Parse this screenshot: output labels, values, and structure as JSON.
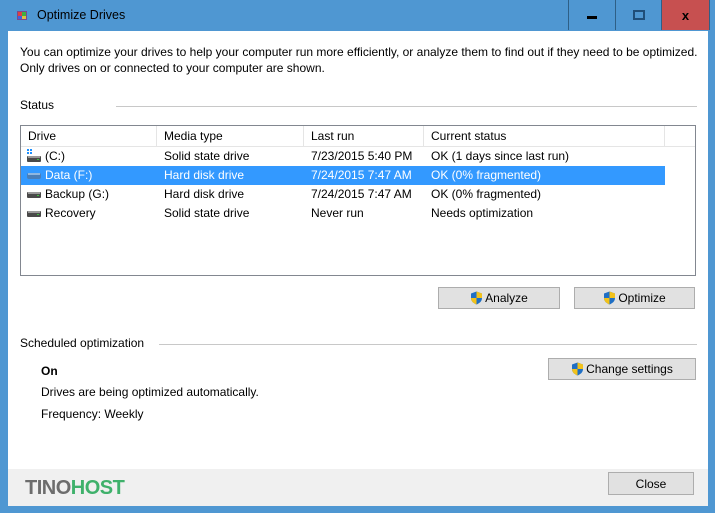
{
  "window": {
    "title": "Optimize Drives",
    "app_icon": "defrag-app-icon",
    "controls": {
      "minimize": "minimize-icon",
      "maximize": "maximize-icon",
      "close": "close-icon",
      "close_glyph": "x"
    }
  },
  "intro_text": "You can optimize your drives to help your computer run more efficiently, or analyze them to find out if they need to be optimized. Only drives on or connected to your computer are shown.",
  "status": {
    "label": "Status",
    "columns": [
      "Drive",
      "Media type",
      "Last run",
      "Current status"
    ],
    "rows": [
      {
        "drive": "(C:)",
        "icon": "system-drive-icon",
        "media_type": "Solid state drive",
        "last_run": "7/23/2015 5:40 PM",
        "current_status": "OK (1 days since last run)",
        "selected": false
      },
      {
        "drive": "Data (F:)",
        "icon": "hard-drive-icon",
        "media_type": "Hard disk drive",
        "last_run": "7/24/2015 7:47 AM",
        "current_status": "OK (0% fragmented)",
        "selected": true
      },
      {
        "drive": "Backup (G:)",
        "icon": "hard-drive-icon",
        "media_type": "Hard disk drive",
        "last_run": "7/24/2015 7:47 AM",
        "current_status": "OK (0% fragmented)",
        "selected": false
      },
      {
        "drive": "Recovery",
        "icon": "hard-drive-icon",
        "media_type": "Solid state drive",
        "last_run": "Never run",
        "current_status": "Needs optimization",
        "selected": false
      }
    ],
    "buttons": {
      "analyze": "Analyze",
      "optimize": "Optimize"
    }
  },
  "scheduled": {
    "label": "Scheduled optimization",
    "state": "On",
    "description": "Drives are being optimized automatically.",
    "frequency": "Frequency: Weekly",
    "change_settings": "Change settings"
  },
  "footer": {
    "logo_part1": "TINO",
    "logo_part2": "HOST",
    "close_label": "Close"
  },
  "colors": {
    "titlebar": "#4f97d2",
    "close_button": "#c75050",
    "selection": "#3399ff",
    "logo_gray": "#6d6d6d",
    "logo_green": "#3fb16b"
  }
}
